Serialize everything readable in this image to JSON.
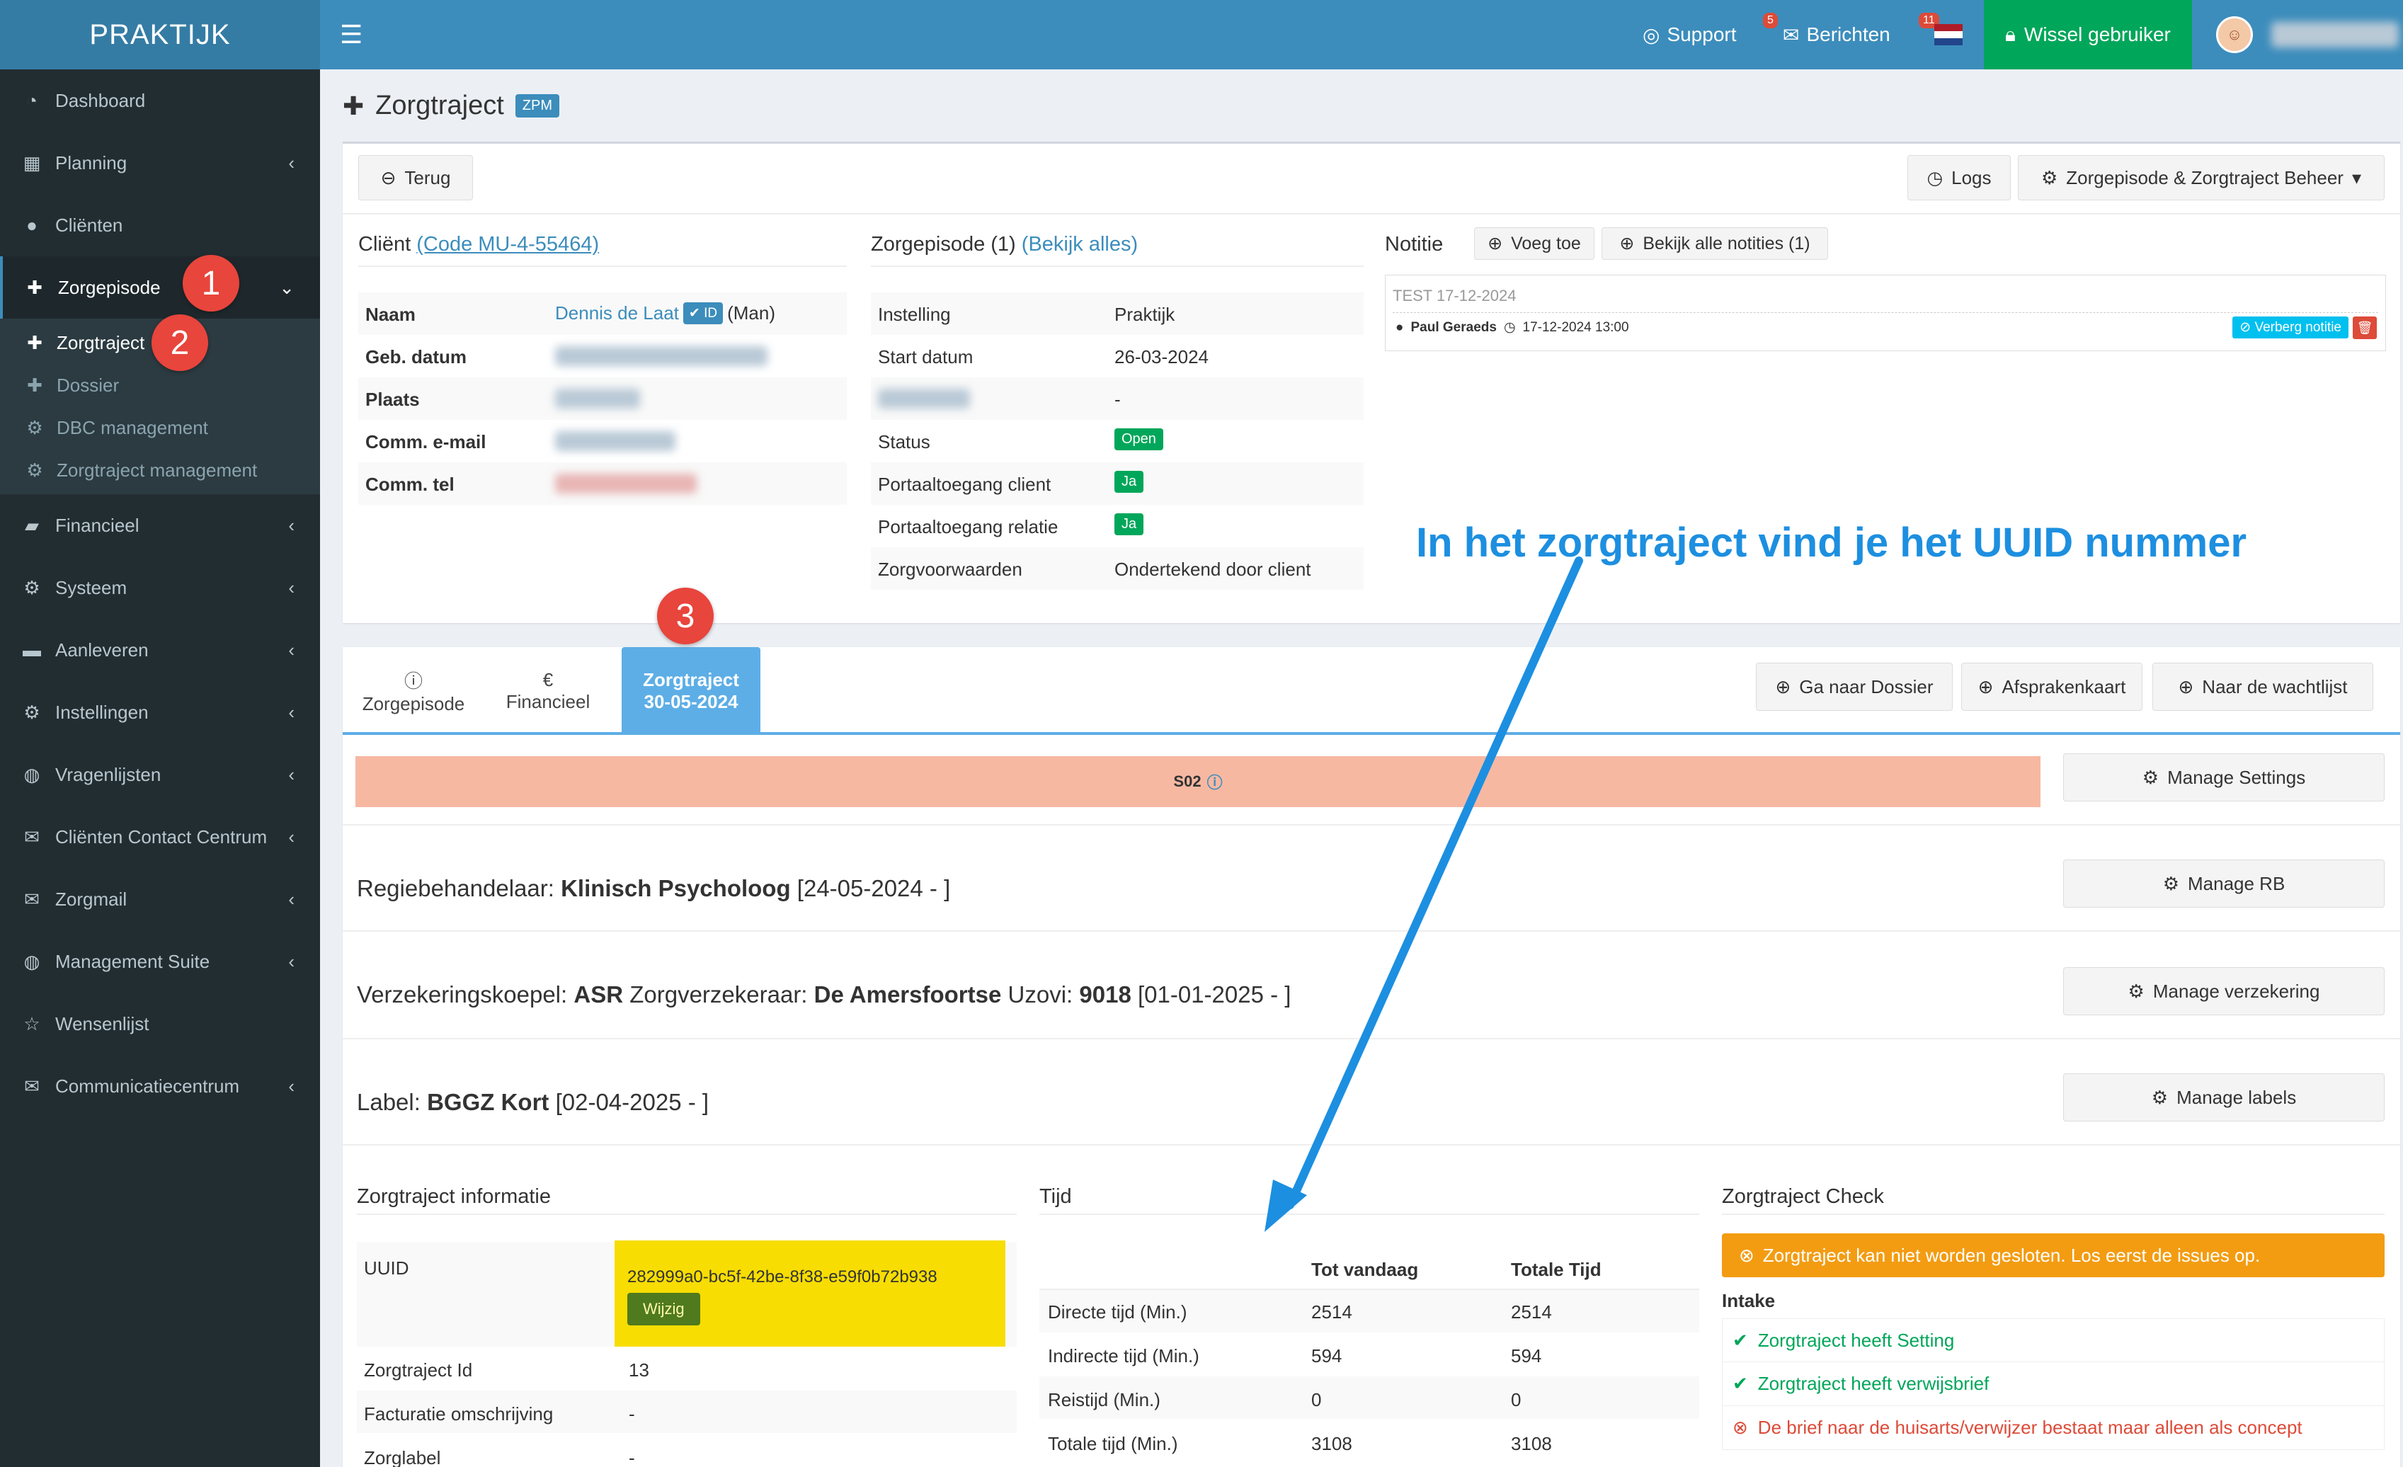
{
  "app": {
    "logo": "PRAKTIJK"
  },
  "topbar": {
    "support_label": "Support",
    "support_badge": "5",
    "messages_label": "Berichten",
    "messages_badge": "11",
    "switch_user_label": "Wissel gebruiker",
    "flag_colors": [
      "#ae1c28",
      "#ffffff",
      "#21468b"
    ]
  },
  "sidebar": {
    "items": [
      {
        "label": "Dashboard",
        "icon": "dashboard-icon"
      },
      {
        "label": "Planning",
        "icon": "calendar-icon"
      },
      {
        "label": "Cliënten",
        "icon": "user-icon"
      },
      {
        "label": "Zorgepisode",
        "icon": "medkit-icon"
      },
      {
        "label": "Financieel",
        "icon": "book-icon"
      },
      {
        "label": "Systeem",
        "icon": "cogs-icon"
      },
      {
        "label": "Aanleveren",
        "icon": "truck-icon"
      },
      {
        "label": "Instellingen",
        "icon": "gear-icon"
      },
      {
        "label": "Vragenlijsten",
        "icon": "globe-icon"
      },
      {
        "label": "Cliënten Contact Centrum",
        "icon": "envelope-icon"
      },
      {
        "label": "Zorgmail",
        "icon": "envelope-icon"
      },
      {
        "label": "Management Suite",
        "icon": "globe-icon"
      },
      {
        "label": "Wensenlijst",
        "icon": "star-icon"
      },
      {
        "label": "Communicatiecentrum",
        "icon": "envelope-icon"
      }
    ],
    "sub_items": [
      {
        "label": "Zorgtraject"
      },
      {
        "label": "Dossier"
      },
      {
        "label": "DBC management"
      },
      {
        "label": "Zorgtraject management"
      }
    ]
  },
  "markers": [
    "1",
    "2",
    "3"
  ],
  "page": {
    "title": "Zorgtraject",
    "badge": "ZPM",
    "back_label": "Terug",
    "logs_label": "Logs",
    "manage_label": "Zorgepisode & Zorgtraject Beheer"
  },
  "client": {
    "title": "Cliënt",
    "code_link": "(Code MU-4-55464)",
    "rows": [
      {
        "label": "Naam",
        "value": "Dennis de Laat",
        "id_badge": "ID",
        "suffix": "(Man)"
      },
      {
        "label": "Geb. datum"
      },
      {
        "label": "Plaats"
      },
      {
        "label": "Comm. e-mail"
      },
      {
        "label": "Comm. tel"
      }
    ]
  },
  "episode": {
    "title": "Zorgepisode (1)",
    "view_all_link": "(Bekijk alles)",
    "rows": [
      {
        "label": "Instelling",
        "value": "Praktijk"
      },
      {
        "label": "Start datum",
        "value": "26-03-2024"
      },
      {
        "label": "",
        "value": "-"
      },
      {
        "label": "Status",
        "value": "Open"
      },
      {
        "label": "Portaaltoegang client",
        "value": "Ja"
      },
      {
        "label": "Portaaltoegang relatie",
        "value": "Ja"
      },
      {
        "label": "Zorgvoorwaarden",
        "value": "Ondertekend door client"
      }
    ]
  },
  "note": {
    "title": "Notitie",
    "add_label": "Voeg toe",
    "view_all_label": "Bekijk alle notities (1)",
    "entry_text": "TEST 17-12-2024",
    "author": "Paul Geraeds",
    "timestamp": "17-12-2024 13:00",
    "hide_label": "Verberg notitie"
  },
  "annotation": {
    "text": "In het zorgtraject vind je het UUID nummer"
  },
  "tabs": [
    {
      "label": "Zorgepisode",
      "icon": "ⓘ"
    },
    {
      "label": "Financieel",
      "icon": "€"
    },
    {
      "label": "Zorgtraject",
      "sub": "30-05-2024"
    }
  ],
  "actions": {
    "dossier": "Ga naar Dossier",
    "appointments": "Afsprakenkaart",
    "waitlist": "Naar de wachtlijst"
  },
  "setting_bar": {
    "code": "S02",
    "button": "Manage Settings"
  },
  "details": {
    "regie": {
      "label": "Regiebehandelaar:",
      "value": "Klinisch Psycholoog",
      "period": "[24-05-2024 - ]",
      "button": "Manage RB"
    },
    "insurance": {
      "k_label": "Verzekeringskoepel:",
      "k_value": "ASR",
      "z_label": "Zorgverzekeraar:",
      "z_value": "De Amersfoortse",
      "u_label": "Uzovi:",
      "u_value": "9018",
      "period": "[01-01-2025 - ]",
      "button": "Manage verzekering"
    },
    "label": {
      "label": "Label:",
      "value": "BGGZ Kort",
      "period": "[02-04-2025 - ]",
      "button": "Manage labels"
    }
  },
  "info": {
    "title": "Zorgtraject informatie",
    "uuid_label": "UUID",
    "uuid_value": "282999a0-bc5f-42be-8f38-e59f0b72b938",
    "edit_label": "Wijzig",
    "rows": [
      {
        "label": "Zorgtraject Id",
        "value": "13"
      },
      {
        "label": "Facturatie omschrijving",
        "value": "-"
      },
      {
        "label": "Zorglabel",
        "value": "-"
      }
    ]
  },
  "time": {
    "title": "Tijd",
    "col1": "Tot vandaag",
    "col2": "Totale Tijd",
    "rows": [
      {
        "label": "Directe tijd (Min.)",
        "a": "2514",
        "b": "2514"
      },
      {
        "label": "Indirecte tijd (Min.)",
        "a": "594",
        "b": "594"
      },
      {
        "label": "Reistijd (Min.)",
        "a": "0",
        "b": "0"
      },
      {
        "label": "Totale tijd (Min.)",
        "a": "3108",
        "b": "3108"
      }
    ]
  },
  "check": {
    "title": "Zorgtraject Check",
    "alert": "Zorgtraject kan niet worden gesloten. Los eerst de issues op.",
    "intake_label": "Intake",
    "items": [
      {
        "text": "Zorgtraject heeft Setting",
        "status": "ok"
      },
      {
        "text": "Zorgtraject heeft verwijsbrief",
        "status": "ok"
      },
      {
        "text": "De brief naar de huisarts/verwijzer bestaat maar alleen als concept",
        "status": "error"
      }
    ]
  },
  "colors": {
    "primary": "#3c8dbc",
    "success": "#00a65a",
    "warning": "#f39c12",
    "danger": "#dd4b39",
    "setting_bar": "#f7b8a2",
    "uuid_highlight": "#f7dd02",
    "annotation": "#1d8fe0"
  }
}
